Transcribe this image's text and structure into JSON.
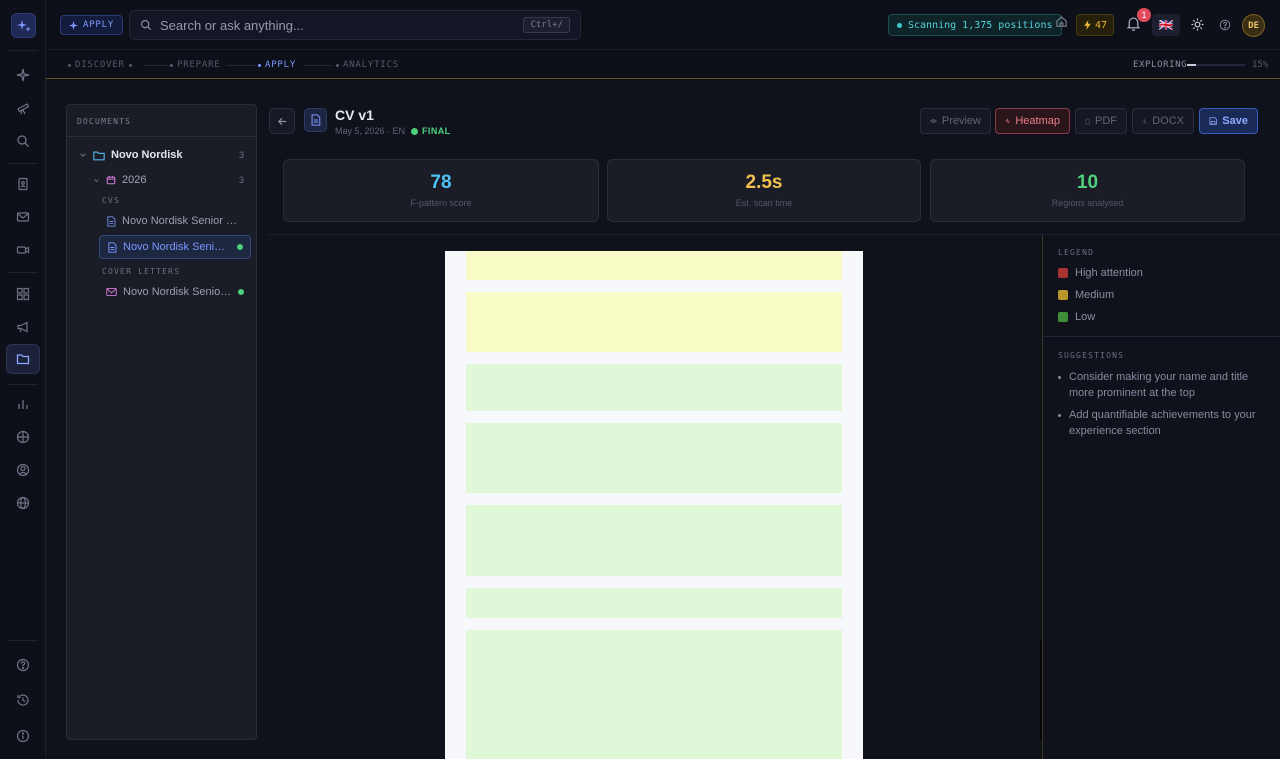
{
  "topbar": {
    "apply_badge": "APPLY",
    "search_placeholder": "Search or ask anything...",
    "search_shortcut": "Ctrl+/",
    "scan_status": "Scanning 1,375 positions",
    "credits": "47",
    "notification_count": "1",
    "language_flag": "🇬🇧",
    "avatar_initials": "DE"
  },
  "steps": {
    "items": [
      "DISCOVER",
      "PREPARE",
      "APPLY",
      "ANALYTICS"
    ],
    "active": "APPLY",
    "explore_label": "EXPLORING",
    "explore_progress": 0.15,
    "explore_pct": "15%"
  },
  "documents": {
    "header": "DOCUMENTS",
    "folder": {
      "name": "Novo Nordisk",
      "count": "3"
    },
    "year": {
      "name": "2026",
      "count": "3"
    },
    "cvs_label": "CVS",
    "cvs": [
      {
        "name": "Novo Nordisk Senior Ma...",
        "selected": false,
        "status": ""
      },
      {
        "name": "Novo Nordisk Senior ...",
        "selected": true,
        "status": "green"
      }
    ],
    "cover_letters_label": "COVER LETTERS",
    "cover_letters": [
      {
        "name": "Novo Nordisk Senior ...",
        "status": "green"
      }
    ]
  },
  "doc": {
    "title": "CV v1",
    "meta": "May 5, 2026 · EN",
    "status": "FINAL"
  },
  "toolbar": {
    "preview": "Preview",
    "heatmap": "Heatmap",
    "pdf": "PDF",
    "docx": "DOCX",
    "save": "Save"
  },
  "stats": [
    {
      "value": "78",
      "label": "F-pattern score",
      "color": "#4fc3f7"
    },
    {
      "value": "2.5s",
      "label": "Est. scan time",
      "color": "#f2c14e"
    },
    {
      "value": "10",
      "label": "Regions analysed",
      "color": "#4fd07d"
    }
  ],
  "heatmap_regions": [
    {
      "level": "medium"
    },
    {
      "level": "medium"
    },
    {
      "level": "low"
    },
    {
      "level": "low"
    },
    {
      "level": "low"
    },
    {
      "level": "low"
    },
    {
      "level": "low"
    }
  ],
  "heat_colors": {
    "high": "#f6c3bd",
    "medium": "#f9fbc6",
    "low": "#e1f8d8"
  },
  "legend": {
    "header": "LEGEND",
    "items": [
      {
        "label": "High attention",
        "color": "#a93232"
      },
      {
        "label": "Medium",
        "color": "#b8962a"
      },
      {
        "label": "Low",
        "color": "#3f8f39"
      }
    ]
  },
  "suggestions": {
    "header": "SUGGESTIONS",
    "items": [
      "Consider making your name and title more prominent at the top",
      "Add quantifiable achievements to your experience section"
    ]
  }
}
